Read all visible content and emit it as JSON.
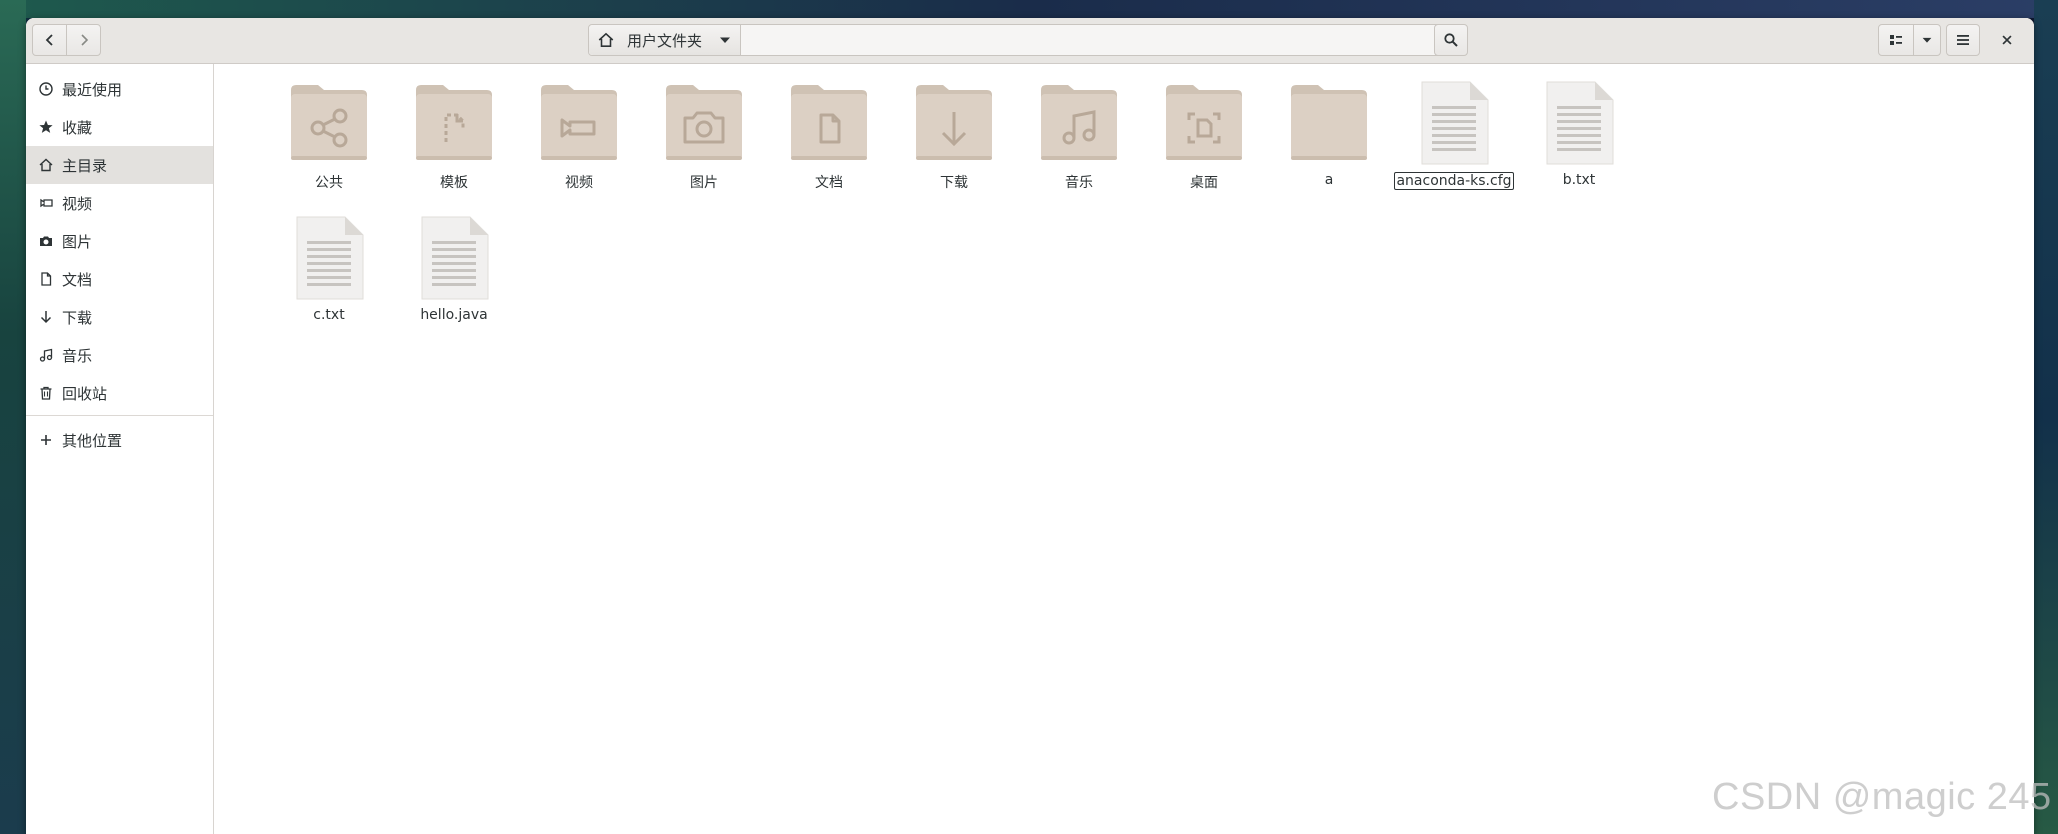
{
  "window": {
    "path_label": "用户文件夹"
  },
  "sidebar": {
    "items": [
      {
        "label": "最近使用",
        "icon": "clock-icon"
      },
      {
        "label": "收藏",
        "icon": "star-icon"
      },
      {
        "label": "主目录",
        "icon": "home-icon",
        "active": true
      },
      {
        "label": "视频",
        "icon": "video-icon"
      },
      {
        "label": "图片",
        "icon": "camera-icon"
      },
      {
        "label": "文档",
        "icon": "document-icon"
      },
      {
        "label": "下载",
        "icon": "download-icon"
      },
      {
        "label": "音乐",
        "icon": "music-icon"
      },
      {
        "label": "回收站",
        "icon": "trash-icon"
      }
    ],
    "other_locations": {
      "label": "其他位置",
      "icon": "plus-icon"
    }
  },
  "files": [
    {
      "name": "公共",
      "kind": "folder",
      "emblem": "share-icon"
    },
    {
      "name": "模板",
      "kind": "folder",
      "emblem": "template-icon"
    },
    {
      "name": "视频",
      "kind": "folder",
      "emblem": "video-icon"
    },
    {
      "name": "图片",
      "kind": "folder",
      "emblem": "camera-icon"
    },
    {
      "name": "文档",
      "kind": "folder",
      "emblem": "document-icon"
    },
    {
      "name": "下载",
      "kind": "folder",
      "emblem": "download-icon"
    },
    {
      "name": "音乐",
      "kind": "folder",
      "emblem": "music-icon"
    },
    {
      "name": "桌面",
      "kind": "folder",
      "emblem": "desktop-icon"
    },
    {
      "name": "a",
      "kind": "folder",
      "emblem": "none"
    },
    {
      "name": "anaconda-ks.cfg",
      "kind": "file",
      "selected": true
    },
    {
      "name": "b.txt",
      "kind": "file"
    },
    {
      "name": "c.txt",
      "kind": "file"
    },
    {
      "name": "hello.java",
      "kind": "file"
    }
  ],
  "watermark": "CSDN @magic 245",
  "colors": {
    "folder_body": "#dcd0c4",
    "folder_tab": "#cfc2b4",
    "folder_emblem": "#b8a898",
    "file_body": "#f1f0ef",
    "file_lines": "#c7c4c0",
    "sidebar_active": "#e3e1de",
    "headerbar": "#e8e6e3"
  }
}
